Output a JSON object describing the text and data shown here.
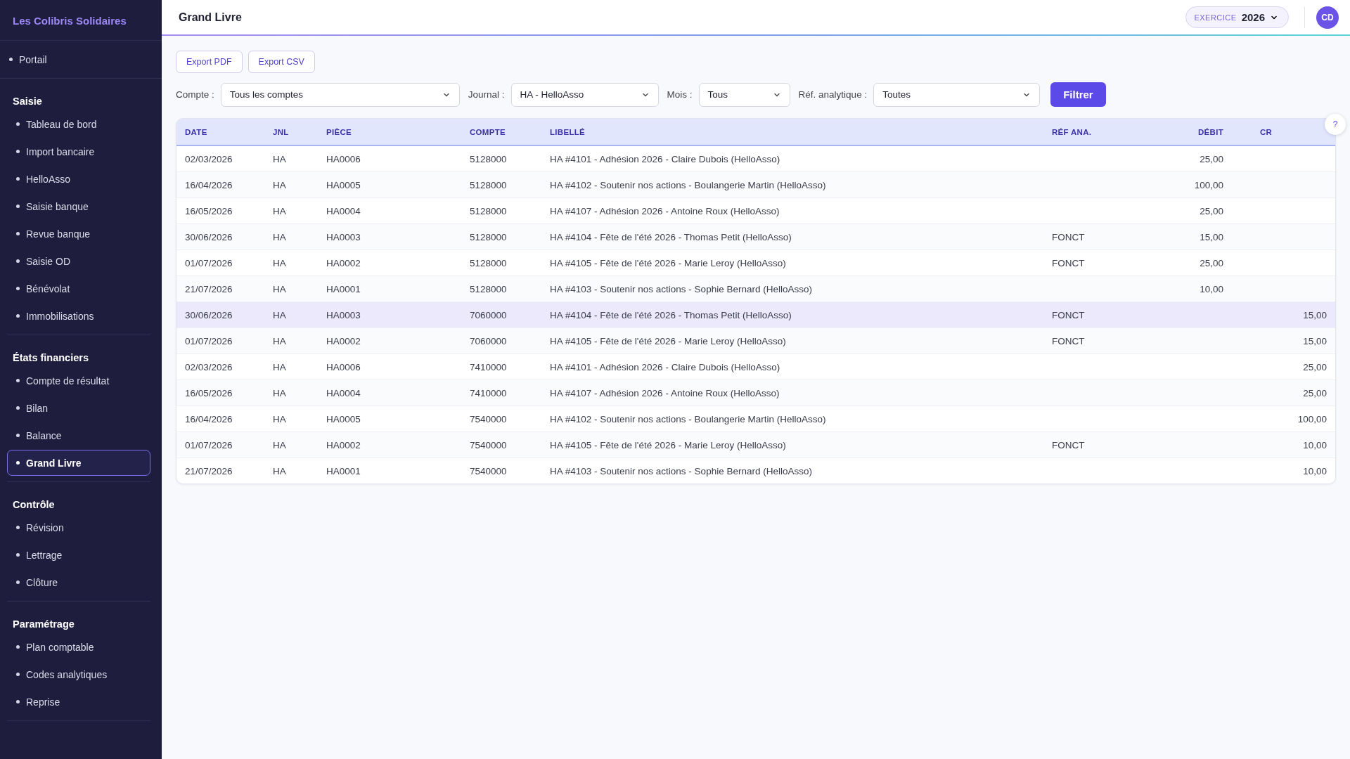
{
  "sidebar": {
    "brand": "Les Colibris Solidaires",
    "sections": [
      {
        "items": [
          {
            "label": "Portail",
            "selected": false
          }
        ]
      },
      {
        "title": "Saisie",
        "items": [
          {
            "label": "Tableau de bord",
            "selected": false
          },
          {
            "label": "Import bancaire",
            "selected": false
          },
          {
            "label": "HelloAsso",
            "selected": false
          },
          {
            "label": "Saisie banque",
            "selected": false
          },
          {
            "label": "Revue banque",
            "selected": false
          },
          {
            "label": "Saisie OD",
            "selected": false
          },
          {
            "label": "Bénévolat",
            "selected": false
          },
          {
            "label": "Immobilisations",
            "selected": false
          }
        ]
      },
      {
        "title": "États financiers",
        "items": [
          {
            "label": "Compte de résultat",
            "selected": false
          },
          {
            "label": "Bilan",
            "selected": false
          },
          {
            "label": "Balance",
            "selected": false
          },
          {
            "label": "Grand Livre",
            "selected": true
          }
        ]
      },
      {
        "title": "Contrôle",
        "items": [
          {
            "label": "Révision",
            "selected": false
          },
          {
            "label": "Lettrage",
            "selected": false
          },
          {
            "label": "Clôture",
            "selected": false
          }
        ]
      },
      {
        "title": "Paramétrage",
        "items": [
          {
            "label": "Plan comptable",
            "selected": false
          },
          {
            "label": "Codes analytiques",
            "selected": false
          },
          {
            "label": "Reprise",
            "selected": false
          }
        ]
      }
    ]
  },
  "topbar": {
    "title": "Grand Livre",
    "exercice_label": "EXERCICE",
    "exercice_value": "2026",
    "avatar": "CD"
  },
  "actions": [
    "Export PDF",
    "Export CSV"
  ],
  "filters": [
    {
      "label": "Compte :",
      "value": "Tous les comptes"
    },
    {
      "label": "Journal :",
      "value": "HA - HelloAsso"
    },
    {
      "label": "Mois :",
      "value": "Tous"
    },
    {
      "label": "Réf. analytique :",
      "value": "Toutes"
    }
  ],
  "filter_button": "Filtrer",
  "help_button": "?",
  "table": {
    "columns": [
      "DATE",
      "JNL",
      "PIÈCE",
      "COMPTE",
      "LIBELLÉ",
      "RÉF ANA.",
      "DÉBIT",
      "CR"
    ],
    "rows": [
      {
        "date": "02/03/2026",
        "jnl": "HA",
        "piece": "HA0006",
        "compte": "5128000",
        "libelle": "HA #4101 - Adhésion 2026 - Claire Dubois (HelloAsso)",
        "debit": "25,00",
        "selected": false
      },
      {
        "date": "16/04/2026",
        "jnl": "HA",
        "piece": "HA0005",
        "compte": "5128000",
        "libelle": "HA #4102 - Soutenir nos actions - Boulangerie Martin (HelloAsso)",
        "debit": "100,00",
        "selected": false
      },
      {
        "date": "16/05/2026",
        "jnl": "HA",
        "piece": "HA0004",
        "compte": "5128000",
        "libelle": "HA #4107 - Adhésion 2026 - Antoine Roux (HelloAsso)",
        "debit": "25,00",
        "selected": false
      },
      {
        "date": "30/06/2026",
        "jnl": "HA",
        "piece": "HA0003",
        "compte": "5128000",
        "libelle": "HA #4104 - Fête de l'été 2026 - Thomas Petit (HelloAsso)",
        "ref": "FONCT",
        "debit": "15,00",
        "selected": false
      },
      {
        "date": "01/07/2026",
        "jnl": "HA",
        "piece": "HA0002",
        "compte": "5128000",
        "libelle": "HA #4105 - Fête de l'été 2026 - Marie Leroy (HelloAsso)",
        "ref": "FONCT",
        "debit": "25,00",
        "selected": false
      },
      {
        "date": "21/07/2026",
        "jnl": "HA",
        "piece": "HA0001",
        "compte": "5128000",
        "libelle": "HA #4103 - Soutenir nos actions - Sophie Bernard (HelloAsso)",
        "debit": "10,00",
        "selected": false
      },
      {
        "date": "30/06/2026",
        "jnl": "HA",
        "piece": "HA0003",
        "compte": "7060000",
        "libelle": "HA #4104 - Fête de l'été 2026 - Thomas Petit (HelloAsso)",
        "ref": "FONCT",
        "credit": "15,00",
        "selected": true
      },
      {
        "date": "01/07/2026",
        "jnl": "HA",
        "piece": "HA0002",
        "compte": "7060000",
        "libelle": "HA #4105 - Fête de l'été 2026 - Marie Leroy (HelloAsso)",
        "ref": "FONCT",
        "credit": "15,00",
        "selected": false
      },
      {
        "date": "02/03/2026",
        "jnl": "HA",
        "piece": "HA0006",
        "compte": "7410000",
        "libelle": "HA #4101 - Adhésion 2026 - Claire Dubois (HelloAsso)",
        "credit": "25,00",
        "selected": false
      },
      {
        "date": "16/05/2026",
        "jnl": "HA",
        "piece": "HA0004",
        "compte": "7410000",
        "libelle": "HA #4107 - Adhésion 2026 - Antoine Roux (HelloAsso)",
        "credit": "25,00",
        "selected": false
      },
      {
        "date": "16/04/2026",
        "jnl": "HA",
        "piece": "HA0005",
        "compte": "7540000",
        "libelle": "HA #4102 - Soutenir nos actions - Boulangerie Martin (HelloAsso)",
        "credit": "100,00",
        "selected": false
      },
      {
        "date": "01/07/2026",
        "jnl": "HA",
        "piece": "HA0002",
        "compte": "7540000",
        "libelle": "HA #4105 - Fête de l'été 2026 - Marie Leroy (HelloAsso)",
        "ref": "FONCT",
        "credit": "10,00",
        "selected": false
      },
      {
        "date": "21/07/2026",
        "jnl": "HA",
        "piece": "HA0001",
        "compte": "7540000",
        "libelle": "HA #4103 - Soutenir nos actions - Sophie Bernard (HelloAsso)",
        "credit": "10,00",
        "selected": false
      }
    ]
  }
}
